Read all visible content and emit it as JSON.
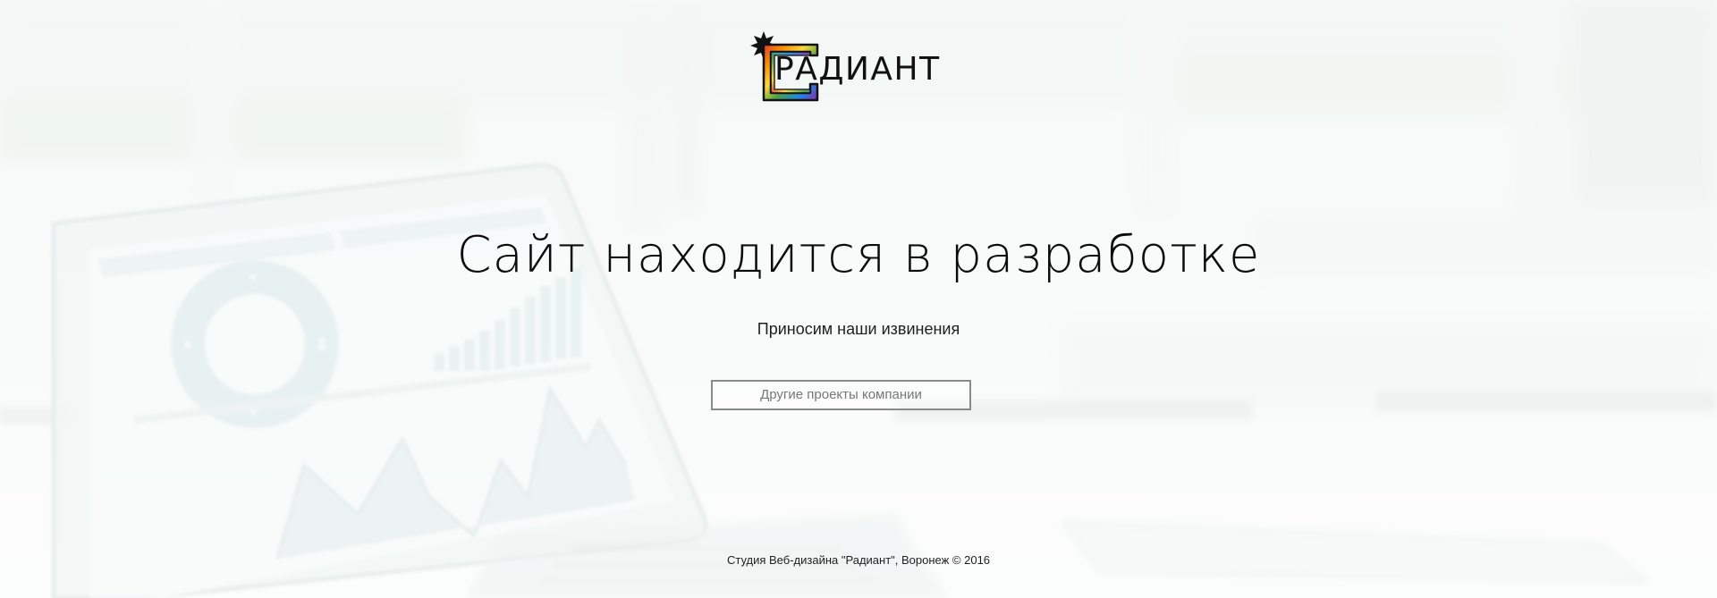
{
  "logo": {
    "text": "РАДИАНТ",
    "icon": "radiant-frame-logo-icon"
  },
  "main": {
    "headline": "Сайт находится в разработке",
    "subheadline": "Приносим наши извинения",
    "projects_button": "Другие проекты компании"
  },
  "footer": {
    "copyright": "Студия Веб-дизайна \"Радиант\", Воронеж © 2016"
  },
  "colors": {
    "background": "#eef4f1",
    "text": "#0b0b0b",
    "button_border": "#8a8a8a",
    "button_text": "#777777"
  }
}
